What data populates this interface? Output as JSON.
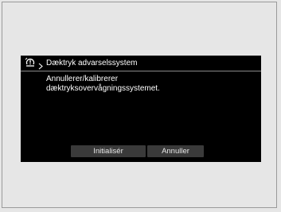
{
  "screen": {
    "breadcrumb_icon": "tire-pressure-icon",
    "separator_icon": "chevron-right-icon",
    "title": "Dæktryk advarselssystem",
    "message_lines": [
      "Annullerer/kalibrerer",
      "dæktryksovervågningssystemet."
    ]
  },
  "buttons": {
    "initialize_label": "Initialisér",
    "cancel_label": "Annuller"
  },
  "colors": {
    "screen_background": "#000000",
    "button_background": "#3a3a3a",
    "text": "#ffffff",
    "page_background": "#e6e6e6"
  }
}
